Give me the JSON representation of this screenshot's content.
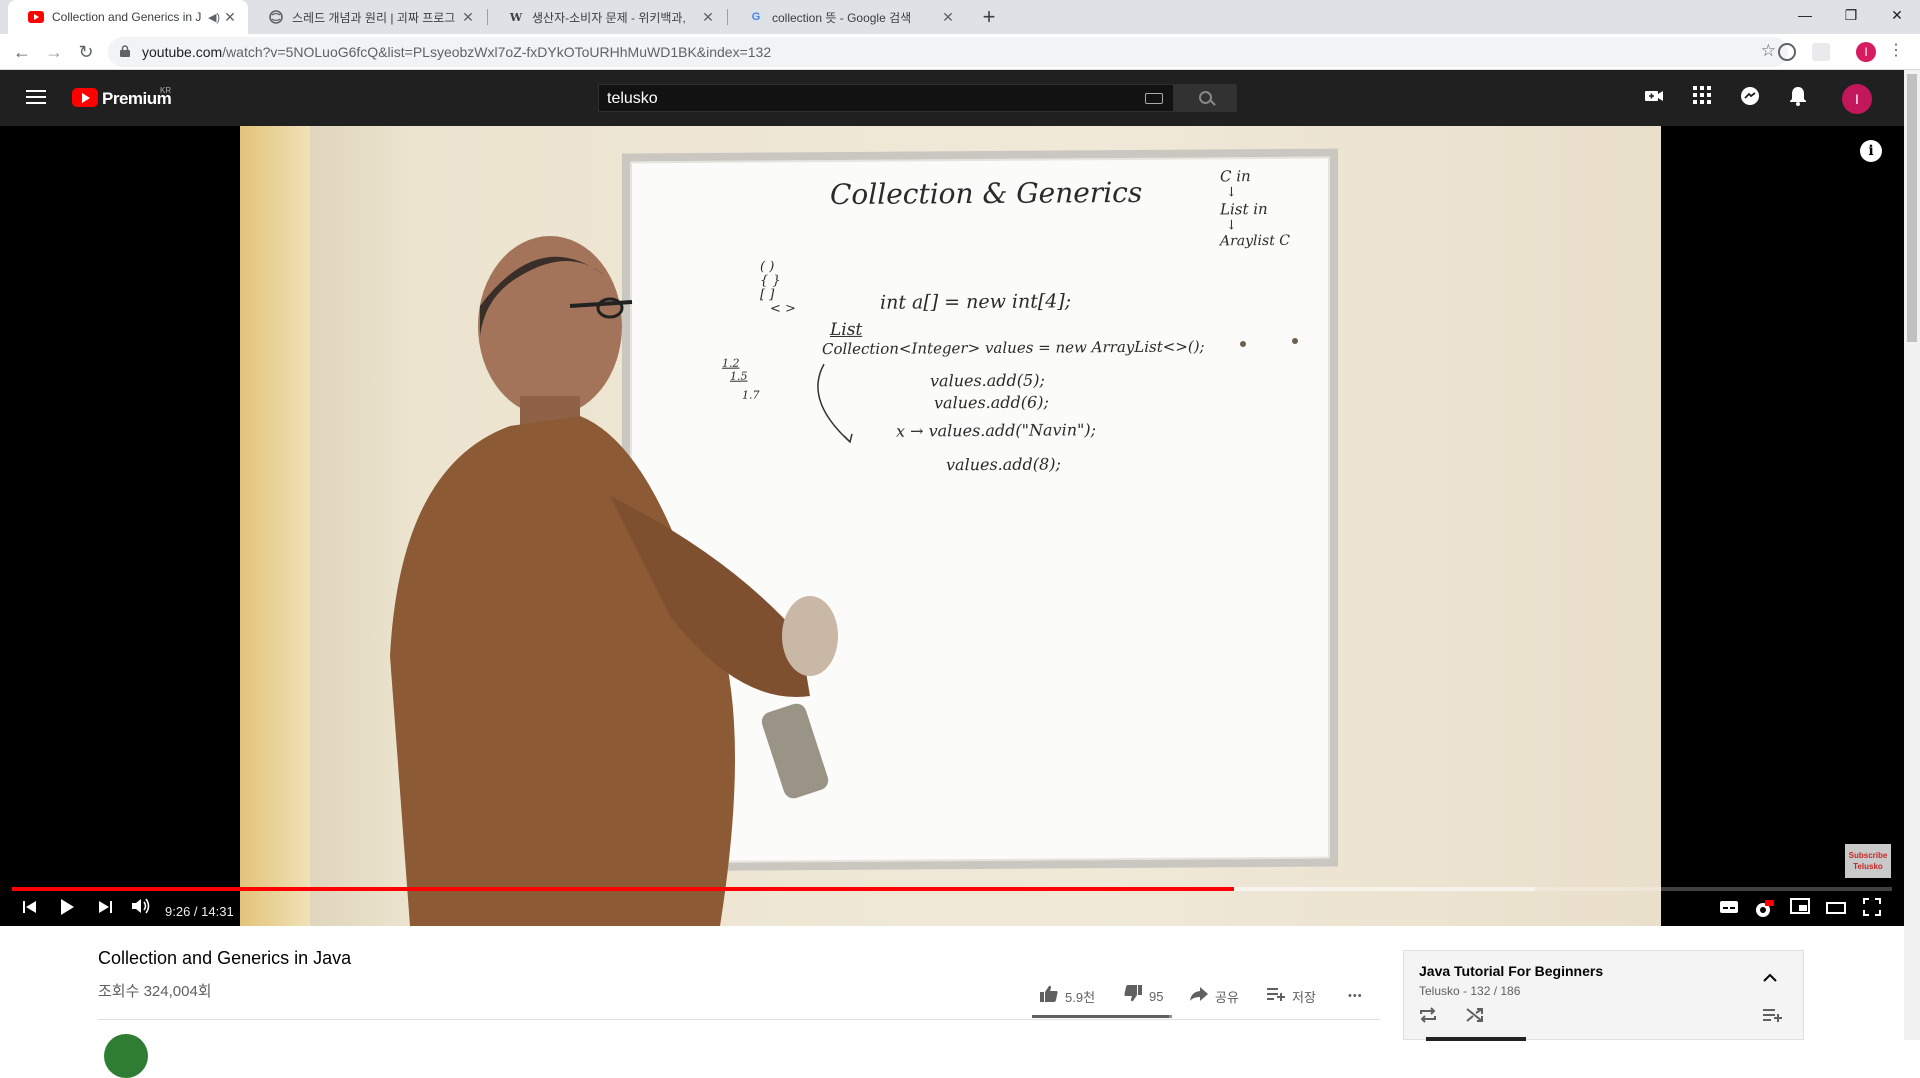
{
  "browser": {
    "tabs": [
      {
        "title": "Collection and Generics in J",
        "favicon": "youtube-icon",
        "active": true
      },
      {
        "title": "스레드 개념과 원리 | 괴짜 프로그",
        "favicon": "globe-icon",
        "active": false
      },
      {
        "title": "생산자-소비자 문제 - 위키백과,",
        "favicon": "wikipedia-icon",
        "active": false
      },
      {
        "title": "collection 뜻 - Google 검색",
        "favicon": "google-icon",
        "active": false
      }
    ],
    "new_tab": "+",
    "url_host": "youtube.com",
    "url_path": "/watch?v=5NOLuoG6fcQ&list=PLsyeobzWxl7oZ-fxDYkOToURHhMuWD1BK&index=132",
    "profile_initial": "I"
  },
  "masthead": {
    "brand": "Premium",
    "region": "KR",
    "search_value": "telusko",
    "avatar_initial": "I"
  },
  "player": {
    "current_time": "9:26",
    "duration": "14:31",
    "time_display": "9:26 / 14:31",
    "progress_fraction": 0.65,
    "buffer_fraction": 0.81,
    "watermark": "Subscribe Telusko",
    "board": {
      "title": "Collection & Generics",
      "corner": [
        "C  in",
        "↓",
        "List  in",
        "↓",
        "Araylist  C"
      ],
      "brackets": [
        "( )",
        "{ }",
        "[ ]",
        "< >"
      ],
      "fractions": [
        "1.2",
        "1.5",
        "1.7"
      ],
      "line1": "int  a[] = new  int[4];",
      "line2_label": "List",
      "line2": "Collection<Integer> values = new  ArrayList<>();",
      "line3": "values.add(5);",
      "line4": "values.add(6);",
      "line5": "x  → values.add(\"Navin\");",
      "line6": "values.add(8);"
    }
  },
  "video": {
    "title": "Collection and Generics in Java",
    "views": "조회수 324,004회",
    "likes": "5.9천",
    "dislikes": "95",
    "share": "공유",
    "save": "저장",
    "more": "•••"
  },
  "playlist": {
    "title": "Java Tutorial For Beginners",
    "subtitle": "Telusko - 132 / 186"
  },
  "colors": {
    "youtube_red": "#ff0000",
    "masthead_bg": "#202020",
    "avatar": "#c2185b"
  }
}
